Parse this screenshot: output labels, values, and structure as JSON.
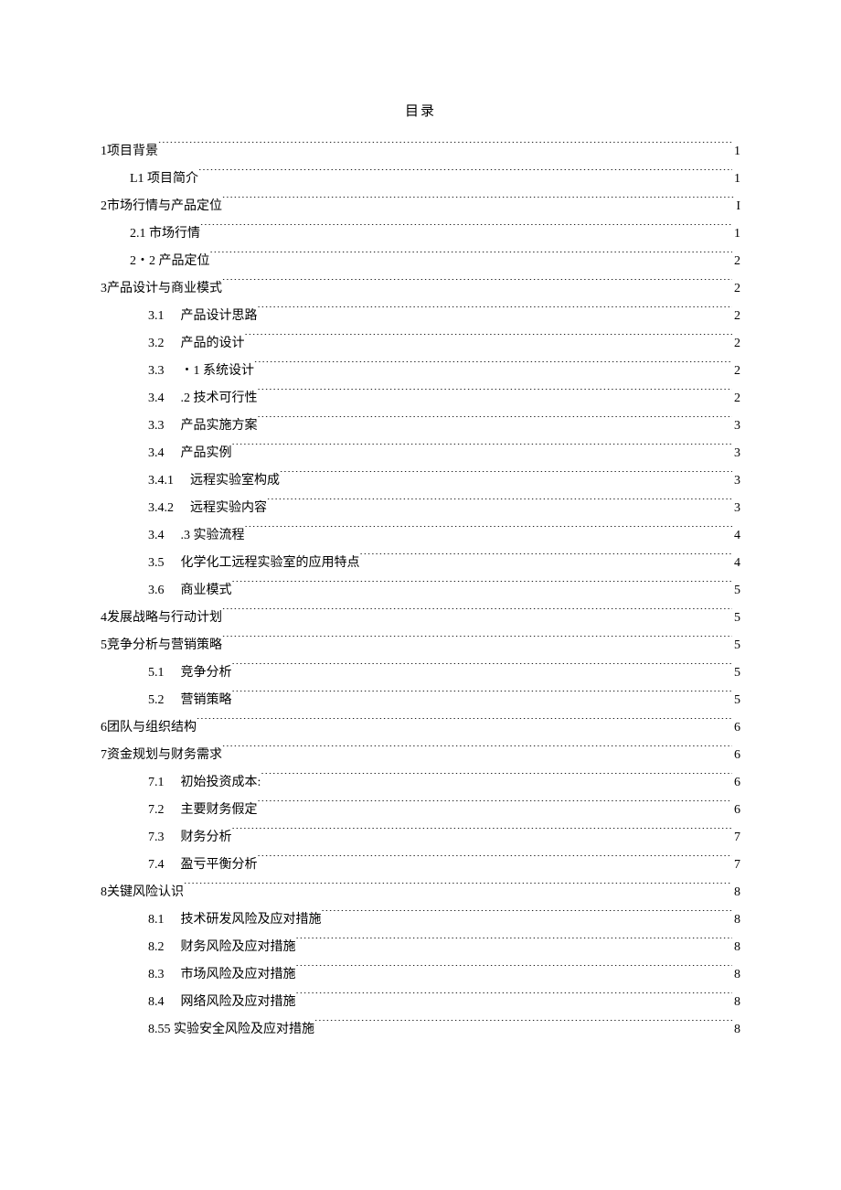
{
  "title": "目录",
  "toc": [
    {
      "indent": 0,
      "num": "1",
      "numpad": false,
      "label": "项目背景 ",
      "page": "1"
    },
    {
      "indent": 1,
      "num": "",
      "numpad": false,
      "label": "L1 项目简介",
      "page": "1"
    },
    {
      "indent": 0,
      "num": "2",
      "numpad": false,
      "label": "市场行情与产品定位 ",
      "page": "I"
    },
    {
      "indent": 1,
      "num": "",
      "numpad": false,
      "label": "2.1 市场行情 ",
      "page": "1"
    },
    {
      "indent": 1,
      "num": "",
      "numpad": false,
      "label": "2・2 产品定位",
      "page": "2"
    },
    {
      "indent": 0,
      "num": "3",
      "numpad": false,
      "label": "产品设计与商业模式 ",
      "page": "2"
    },
    {
      "indent": 2,
      "num": "3.1",
      "numpad": true,
      "label": "产品设计思路",
      "page": "2"
    },
    {
      "indent": 2,
      "num": "3.2",
      "numpad": true,
      "label": "产品的设计",
      "page": "2"
    },
    {
      "indent": 2,
      "num": "3.3",
      "numpad": true,
      "label": "・1 系统设计",
      "page": "2"
    },
    {
      "indent": 2,
      "num": "3.4",
      "numpad": true,
      "label": ".2 技术可行性",
      "page": "2"
    },
    {
      "indent": 2,
      "num": "3.3",
      "numpad": true,
      "label": "产品实施方案",
      "page": "3"
    },
    {
      "indent": 2,
      "num": "3.4",
      "numpad": true,
      "label": "产品实例",
      "page": "3"
    },
    {
      "indent": 2,
      "num": "3.4.1",
      "numpad": true,
      "label": "远程实验室构成 ",
      "page": "3"
    },
    {
      "indent": 2,
      "num": "3.4.2",
      "numpad": true,
      "label": "远程实验内容 ",
      "page": "3"
    },
    {
      "indent": 2,
      "num": "3.4",
      "numpad": true,
      "label": ".3 实验流程",
      "page": "4"
    },
    {
      "indent": 2,
      "num": "3.5",
      "numpad": true,
      "label": "化学化工远程实验室的应用特点 ",
      "page": "4"
    },
    {
      "indent": 2,
      "num": "3.6",
      "numpad": true,
      "label": "商业模式",
      "page": "5"
    },
    {
      "indent": 0,
      "num": "4",
      "numpad": false,
      "label": "发展战略与行动计划 ",
      "page": "5"
    },
    {
      "indent": 0,
      "num": "5",
      "numpad": false,
      "label": "竞争分析与营销策略 ",
      "page": "5"
    },
    {
      "indent": 2,
      "num": "5.1",
      "numpad": true,
      "label": "竞争分析 ",
      "page": "5"
    },
    {
      "indent": 2,
      "num": "5.2",
      "numpad": true,
      "label": "营销策略",
      "page": "5"
    },
    {
      "indent": 0,
      "num": "6",
      "numpad": false,
      "label": "团队与组织结构",
      "page": "6"
    },
    {
      "indent": 0,
      "num": "7",
      "numpad": false,
      "label": "资金规划与财务需求 ",
      "page": "6"
    },
    {
      "indent": 2,
      "num": "7.1",
      "numpad": true,
      "label": "初始投资成本:",
      "page": "6"
    },
    {
      "indent": 2,
      "num": "7.2",
      "numpad": true,
      "label": "主要财务假定",
      "page": "6"
    },
    {
      "indent": 2,
      "num": "7.3",
      "numpad": true,
      "label": "财务分析",
      "page": "7"
    },
    {
      "indent": 2,
      "num": "7.4",
      "numpad": true,
      "label": "盈亏平衡分析 ",
      "page": "7"
    },
    {
      "indent": 0,
      "num": "8",
      "numpad": false,
      "label": "关键风险认识",
      "page": "8"
    },
    {
      "indent": 2,
      "num": "8.1",
      "numpad": true,
      "label": "技术研发风险及应对措施",
      "page": "8"
    },
    {
      "indent": 2,
      "num": "8.2",
      "numpad": true,
      "label": "财务风险及应对措施",
      "page": "8"
    },
    {
      "indent": 2,
      "num": "8.3",
      "numpad": true,
      "label": "市场风险及应对措施",
      "page": "8"
    },
    {
      "indent": 2,
      "num": "8.4",
      "numpad": true,
      "label": "网络风险及应对措施",
      "page": "8"
    },
    {
      "indent": 2,
      "num": "8.5",
      "numpad": false,
      "label": " 5 实验安全风险及应对措施",
      "page": "8"
    }
  ]
}
